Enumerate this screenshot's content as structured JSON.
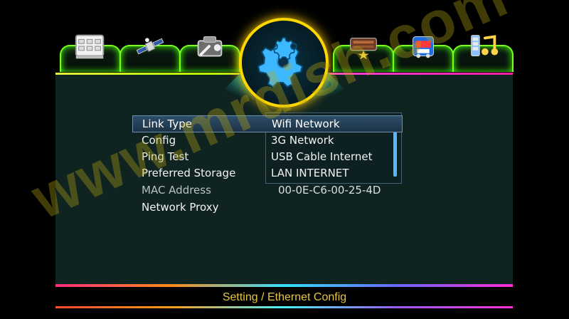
{
  "menu": {
    "items": [
      {
        "label": "Link Type",
        "value": "Wifi Network"
      },
      {
        "label": "Config",
        "value": "3G Network"
      },
      {
        "label": "Ping Test",
        "value": "USB Cable Internet"
      },
      {
        "label": "Preferred Storage",
        "value": "LAN INTERNET"
      },
      {
        "label": "MAC Address",
        "value": "00-0E-C6-00-25-4D"
      },
      {
        "label": "Network Proxy",
        "value": ""
      }
    ]
  },
  "footer": {
    "text": "Setting / Ethernet Config"
  },
  "watermark": {
    "text": "www.mrdish.com"
  },
  "tabs": [
    {
      "icon": "tv-guide-icon"
    },
    {
      "icon": "satellite-icon"
    },
    {
      "icon": "tools-icon"
    },
    {
      "icon": "settings-gears-icon"
    },
    {
      "icon": "media-box-icon"
    },
    {
      "icon": "game-icon"
    },
    {
      "icon": "music-icon"
    }
  ],
  "colors": {
    "panel": "#0f2320",
    "accent_gold": "#ffd700",
    "tab_border": "#77ff22",
    "footer_text": "#e7c544",
    "selection": "#2d4d68"
  }
}
